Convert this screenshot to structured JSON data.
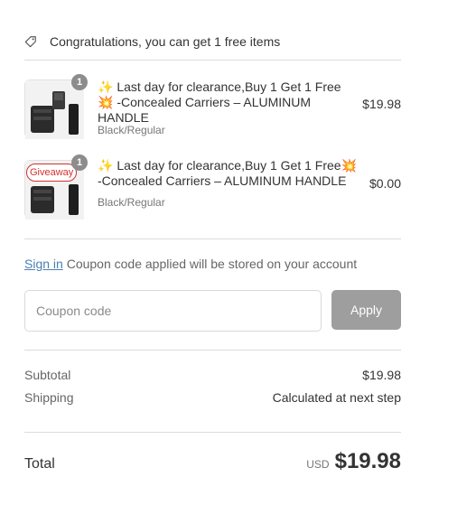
{
  "promo": {
    "text": "Congratulations, you can get 1 free items"
  },
  "items": [
    {
      "quantity": "1",
      "title_line1": " Last day for clearance,Buy 1 Get 1 Free",
      "title_line2": " -Concealed Carriers – ALUMINUM",
      "title_line3": "HANDLE",
      "variant": "Black/Regular",
      "price": "$19.98"
    },
    {
      "quantity": "1",
      "badge": "Giveaway",
      "title_line1": " Last day for clearance,Buy 1 Get 1 Free",
      "title_line2": "-Concealed Carriers – ALUMINUM HANDLE",
      "variant": "Black/Regular",
      "price": "$0.00"
    }
  ],
  "signin": {
    "link": "Sign in",
    "text": " Coupon code applied will be stored on your account"
  },
  "coupon": {
    "placeholder": "Coupon code",
    "apply_label": "Apply"
  },
  "summary": {
    "subtotal_label": "Subtotal",
    "subtotal_value": "$19.98",
    "shipping_label": "Shipping",
    "shipping_value": "Calculated at next step"
  },
  "total": {
    "label": "Total",
    "currency": "USD",
    "amount": "$19.98"
  },
  "icons": {
    "sparkle": "sparkle-emoji-icon",
    "boom": "collision-emoji-icon",
    "tag": "tag-icon"
  },
  "colors": {
    "link": "#4a7fb5",
    "apply_button": "#9e9e9e",
    "giveaway_badge": "#d32f2f"
  }
}
